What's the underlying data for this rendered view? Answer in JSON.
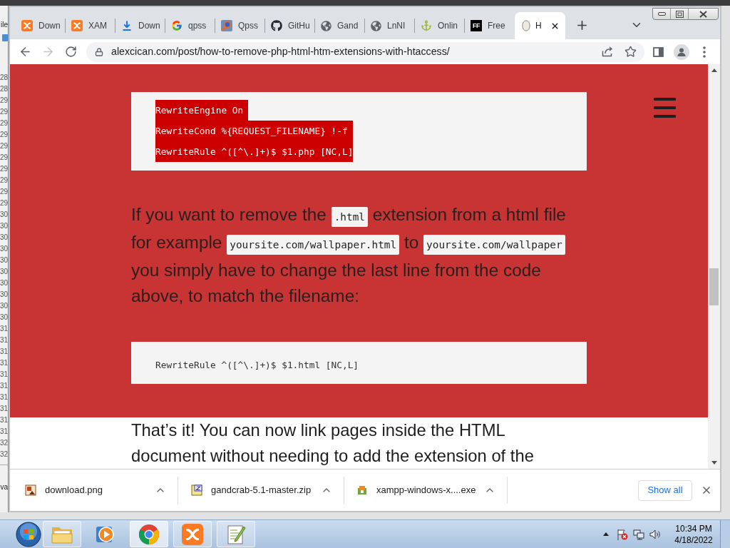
{
  "background_window": {
    "menu_fragment": "ile",
    "line_numbers": [
      "28",
      "28",
      "29",
      "29",
      "29",
      "29",
      "29",
      "29",
      "29",
      "29",
      "29",
      "29",
      "30",
      "30",
      "30",
      "30",
      "30",
      "30",
      "30",
      "30",
      "30",
      "30",
      "31",
      "31",
      "31",
      "31",
      "31",
      "31",
      "31",
      "31",
      "31",
      "31",
      "32",
      "32"
    ],
    "status_fragment": "va"
  },
  "browser": {
    "tabs": [
      {
        "kind": "xampp",
        "label": "Down",
        "selected": false
      },
      {
        "kind": "xampp",
        "label": "XAM",
        "selected": false
      },
      {
        "kind": "download",
        "label": "Down",
        "selected": false
      },
      {
        "kind": "google",
        "label": "qpss",
        "selected": false
      },
      {
        "kind": "qpss",
        "label": "Qpss",
        "selected": false
      },
      {
        "kind": "github",
        "label": "GitHu",
        "selected": false
      },
      {
        "kind": "globe",
        "label": "Gand",
        "selected": false
      },
      {
        "kind": "globe",
        "label": "LnNI",
        "selected": false
      },
      {
        "kind": "anchor",
        "label": "Onlin",
        "selected": false
      },
      {
        "kind": "ff",
        "badge": "FF",
        "label": "Free",
        "selected": false
      },
      {
        "kind": "portrait",
        "label": "H",
        "selected": true
      }
    ],
    "toolbar": {
      "back": {
        "disabled": false
      },
      "forward": {
        "disabled": true
      },
      "url": "alexcican.com/post/how-to-remove-php-html-htm-extensions-with-htaccess/"
    },
    "page": {
      "blocks": [
        {
          "kind": "code",
          "lines": [
            {
              "text": "RewriteEngine On",
              "selected": true
            },
            {
              "text": "RewriteCond %{REQUEST_FILENAME} !-f",
              "selected": true
            },
            {
              "text": "RewriteRule ^([^\\.]+)$ $1.php [NC,L]",
              "selected": true
            }
          ]
        },
        {
          "kind": "paragraph",
          "segments": [
            {
              "kind": "text",
              "text": "If you want to remove the "
            },
            {
              "kind": "code",
              "text": ".html"
            },
            {
              "kind": "text",
              "text": " extension from a html file for example "
            },
            {
              "kind": "code",
              "text": "yoursite.com/wallpaper.html"
            },
            {
              "kind": "text",
              "text": " to "
            },
            {
              "kind": "code",
              "text": "yoursite.com/wallpaper"
            },
            {
              "kind": "text",
              "text": " you simply have to change the last line from the code above, to match the filename:"
            }
          ]
        },
        {
          "kind": "code",
          "lines": [
            {
              "text": "RewriteRule ^([^\\.]+)$ $1.html [NC,L]",
              "selected": false
            }
          ]
        }
      ],
      "closing_text": "That’s it! You can now link pages inside the HTML document without needing to add the extension of the"
    },
    "downloads": {
      "items": [
        {
          "kind": "image",
          "filename": "download.png"
        },
        {
          "kind": "archive",
          "filename": "gandcrab-5.1-master.zip"
        },
        {
          "kind": "installer",
          "filename": "xampp-windows-x....exe"
        }
      ],
      "show_all": "Show all"
    }
  },
  "taskbar": {
    "apps": [
      {
        "kind": "folder",
        "running": true,
        "selected": false
      },
      {
        "kind": "media",
        "running": false,
        "selected": false
      },
      {
        "kind": "chrome",
        "running": true,
        "selected": true
      },
      {
        "kind": "xampp",
        "running": true,
        "selected": false
      },
      {
        "kind": "notepad",
        "running": true,
        "selected": false
      }
    ],
    "clock": {
      "time": "10:34 PM",
      "date": "4/18/2022"
    }
  }
}
